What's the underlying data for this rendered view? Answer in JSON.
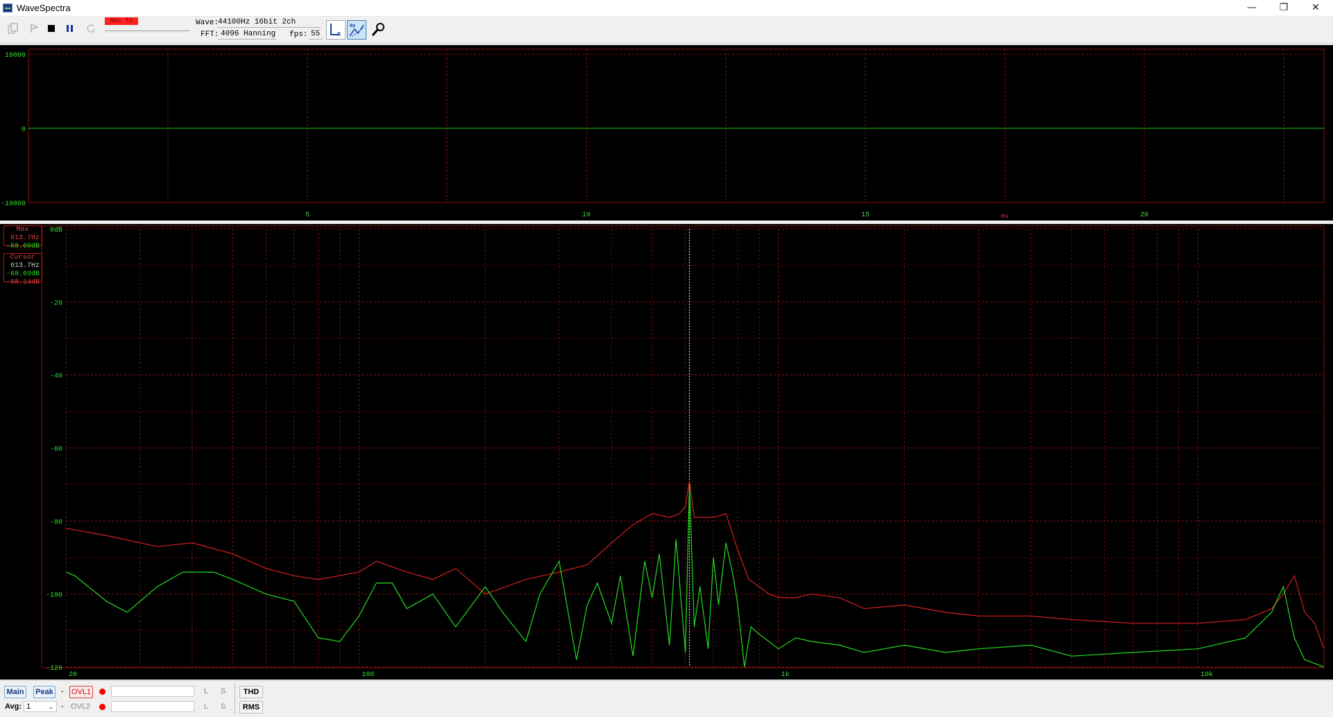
{
  "window": {
    "title": "WaveSpectra",
    "minimize_glyph": "—",
    "restore_glyph": "❐",
    "close_glyph": "✕"
  },
  "toolbar": {
    "rec_label": "Rec To",
    "wave_label": "Wave:",
    "wave_value": "44100Hz 16bit 2ch",
    "fft_label": "FFT:",
    "fft_value": "4096 Hanning",
    "fps_label": "fps:",
    "fps_value": "55",
    "icons": [
      "open-file-icon",
      "play-icon",
      "stop-icon",
      "pause-icon",
      "loop-icon",
      "lr-channel-icon",
      "hz-scale-icon",
      "settings-wrench-icon"
    ]
  },
  "waveform": {
    "y_ticks": [
      "10000",
      "0",
      "-10000"
    ],
    "x_ticks": [
      "5",
      "10",
      "15",
      "20"
    ],
    "x_unit": "ms",
    "colors": {
      "grid": "#8b1010",
      "trace": "#22cc22",
      "text": "#33dd33",
      "unit": "#cc3333"
    }
  },
  "spectrum": {
    "y_ticks": [
      "0dB",
      "-20",
      "-40",
      "-60",
      "-80",
      "-100",
      "-120"
    ],
    "x_ticks": [
      "20",
      "100",
      "1k",
      "10k"
    ],
    "max_box": {
      "header": "Max",
      "freq": "613.7Hz",
      "level": "-68.69dB"
    },
    "cursor_box": {
      "header": "Cursor",
      "freq": "613.7Hz",
      "level_l": "-68.69dB",
      "level_r": "-68.14dB"
    },
    "colors": {
      "left": "#22dd22",
      "right": "#d62020",
      "grid": "#8b1010"
    }
  },
  "chart_data": {
    "type": "line",
    "x_scale": "log",
    "xlim": [
      20,
      20000
    ],
    "ylim": [
      -120,
      0
    ],
    "series": [
      {
        "x": [
          20,
          25,
          33,
          40,
          50,
          60,
          70,
          80,
          100,
          110,
          130,
          150,
          170,
          200,
          250,
          300,
          350,
          400,
          450,
          500,
          550,
          580,
          600,
          613.7,
          630,
          660,
          700,
          750,
          800,
          850,
          900,
          950,
          1000,
          1100,
          1200,
          1400,
          1600,
          2000,
          2500,
          3000,
          4000,
          5000,
          7000,
          10000,
          13000,
          15000,
          16000,
          17000,
          18000,
          19000,
          20000
        ],
        "values": [
          -82,
          -84,
          -87,
          -86,
          -89,
          -93,
          -95,
          -96,
          -94,
          -91,
          -94,
          -96,
          -93,
          -100,
          -96,
          -94,
          -92,
          -86,
          -81,
          -78,
          -79,
          -78,
          -76,
          -69,
          -79,
          -79,
          -79,
          -78,
          -88,
          -96,
          -98,
          -100,
          -101,
          -101,
          -100,
          -101,
          -104,
          -103,
          -105,
          -106,
          -106,
          -107,
          -108,
          -108,
          -107,
          -104,
          -100,
          -95,
          -105,
          -108,
          -115
        ]
      },
      {
        "x": [
          20,
          21,
          25,
          28,
          33,
          38,
          45,
          50,
          60,
          70,
          80,
          90,
          100,
          110,
          120,
          130,
          150,
          170,
          200,
          220,
          250,
          270,
          300,
          330,
          350,
          370,
          400,
          420,
          450,
          480,
          500,
          520,
          550,
          570,
          600,
          613.7,
          630,
          650,
          680,
          700,
          720,
          750,
          780,
          800,
          830,
          860,
          900,
          950,
          1000,
          1100,
          1200,
          1400,
          1600,
          2000,
          2500,
          3000,
          4000,
          5000,
          7000,
          10000,
          13000,
          15000,
          16000,
          17000,
          18000,
          19000,
          20000
        ],
        "values": [
          -94,
          -95,
          -102,
          -105,
          -98,
          -94,
          -94,
          -96,
          -100,
          -102,
          -112,
          -113,
          -106,
          -97,
          -97,
          -104,
          -100,
          -109,
          -98,
          -105,
          -113,
          -100,
          -91,
          -118,
          -103,
          -97,
          -108,
          -95,
          -117,
          -91,
          -101,
          -89,
          -114,
          -85,
          -116,
          -70,
          -109,
          -98,
          -115,
          -90,
          -103,
          -86,
          -95,
          -103,
          -120,
          -109,
          -111,
          -113,
          -115,
          -112,
          -113,
          -114,
          -116,
          -114,
          -116,
          -115,
          -114,
          -117,
          -116,
          -115,
          -112,
          -105,
          -98,
          -112,
          -118,
          -119,
          -120
        ]
      }
    ]
  },
  "bottombar": {
    "main_label": "Main",
    "peak_label": "Peak",
    "dash1": "-",
    "ovl1_label": "OVL1",
    "ovl1_l": "L",
    "ovl1_s": "S",
    "thd_label": "THD",
    "avg_label": "Avg:",
    "avg_value": "1",
    "dash2": "-",
    "ovl2_label": "OVL2",
    "ovl2_l": "L",
    "ovl2_s": "S",
    "rms_label": "RMS"
  }
}
